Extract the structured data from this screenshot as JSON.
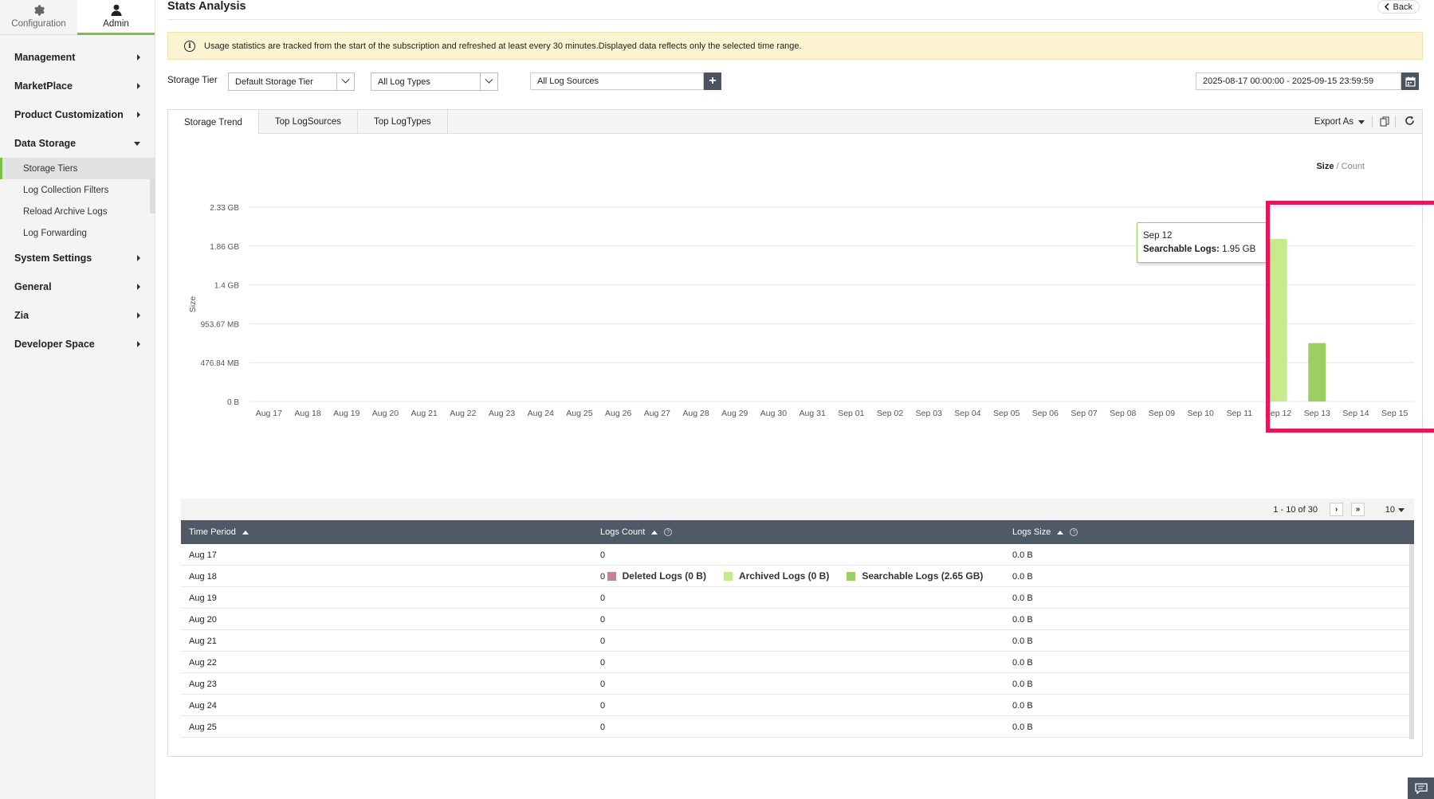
{
  "sidebar": {
    "tabs": [
      {
        "label": "Configuration",
        "icon": "gear-icon"
      },
      {
        "label": "Admin",
        "icon": "user-icon"
      }
    ],
    "menu": [
      "Management",
      "MarketPlace",
      "Product Customization",
      "Data Storage",
      "System Settings",
      "General",
      "Zia",
      "Developer Space"
    ],
    "data_storage_items": [
      "Storage Tiers",
      "Log Collection Filters",
      "Reload Archive Logs",
      "Log Forwarding"
    ],
    "active_item": "Storage Tiers"
  },
  "header": {
    "title": "Stats Analysis",
    "back_label": "Back"
  },
  "banner": {
    "text": "Usage statistics are tracked from the start of the subscription and refreshed at least every 30 minutes.Displayed data reflects only the selected time range."
  },
  "filters": {
    "storage_tier_label": "Storage Tier",
    "storage_tier_value": "Default Storage Tier",
    "log_type_value": "All Log Types",
    "log_sources_value": "All Log Sources",
    "date_range": "2025-08-17 00:00:00 - 2025-09-15 23:59:59"
  },
  "tabs": [
    "Storage Trend",
    "Top LogSources",
    "Top LogTypes"
  ],
  "toolbar": {
    "export_label": "Export As"
  },
  "toggle": {
    "size": "Size",
    "separator": "/",
    "count": "Count"
  },
  "tooltip": {
    "date": "Sep 12",
    "series": "Searchable Logs:",
    "value": "1.95 GB"
  },
  "legend": [
    {
      "label": "Deleted Logs (0 B)",
      "color": "#c0868b"
    },
    {
      "label": "Archived Logs (0 B)",
      "color": "#c7ea8d"
    },
    {
      "label": "Searchable Logs (2.65 GB)",
      "color": "#9ccf61"
    }
  ],
  "chart_data": {
    "type": "bar",
    "ylabel": "Size",
    "y_ticks": [
      "0 B",
      "476.84 MB",
      "953.67 MB",
      "1.4 GB",
      "1.86 GB",
      "2.33 GB"
    ],
    "ylim_gb": [
      0,
      2.33
    ],
    "categories": [
      "Aug 17",
      "Aug 18",
      "Aug 19",
      "Aug 20",
      "Aug 21",
      "Aug 22",
      "Aug 23",
      "Aug 24",
      "Aug 25",
      "Aug 26",
      "Aug 27",
      "Aug 28",
      "Aug 29",
      "Aug 30",
      "Aug 31",
      "Sep 01",
      "Sep 02",
      "Sep 03",
      "Sep 04",
      "Sep 05",
      "Sep 06",
      "Sep 07",
      "Sep 08",
      "Sep 09",
      "Sep 10",
      "Sep 11",
      "Sep 12",
      "Sep 13",
      "Sep 14",
      "Sep 15"
    ],
    "series": [
      {
        "name": "Deleted Logs",
        "color": "#c0868b",
        "values_gb": [
          0,
          0,
          0,
          0,
          0,
          0,
          0,
          0,
          0,
          0,
          0,
          0,
          0,
          0,
          0,
          0,
          0,
          0,
          0,
          0,
          0,
          0,
          0,
          0,
          0,
          0,
          0,
          0,
          0,
          0
        ]
      },
      {
        "name": "Archived Logs",
        "color": "#c7ea8d",
        "values_gb": [
          0,
          0,
          0,
          0,
          0,
          0,
          0,
          0,
          0,
          0,
          0,
          0,
          0,
          0,
          0,
          0,
          0,
          0,
          0,
          0,
          0,
          0,
          0,
          0,
          0,
          0,
          0,
          0,
          0,
          0
        ]
      },
      {
        "name": "Searchable Logs",
        "color": "#9ccf61",
        "values_gb": [
          0,
          0,
          0,
          0,
          0,
          0,
          0,
          0,
          0,
          0,
          0,
          0,
          0,
          0,
          0,
          0,
          0,
          0,
          0,
          0,
          0,
          0,
          0,
          0,
          0,
          0,
          1.95,
          0.7,
          0,
          0
        ]
      }
    ],
    "highlighted_category": "Sep 12",
    "grid": true,
    "legend_position": "bottom"
  },
  "table": {
    "pager_text": "1 - 10 of 30",
    "page_size": "10",
    "columns": [
      "Time Period",
      "Logs Count",
      "Logs Size"
    ],
    "rows": [
      [
        "Aug 17",
        "0",
        "0.0 B"
      ],
      [
        "Aug 18",
        "0",
        "0.0 B"
      ],
      [
        "Aug 19",
        "0",
        "0.0 B"
      ],
      [
        "Aug 20",
        "0",
        "0.0 B"
      ],
      [
        "Aug 21",
        "0",
        "0.0 B"
      ],
      [
        "Aug 22",
        "0",
        "0.0 B"
      ],
      [
        "Aug 23",
        "0",
        "0.0 B"
      ],
      [
        "Aug 24",
        "0",
        "0.0 B"
      ],
      [
        "Aug 25",
        "0",
        "0.0 B"
      ]
    ]
  }
}
